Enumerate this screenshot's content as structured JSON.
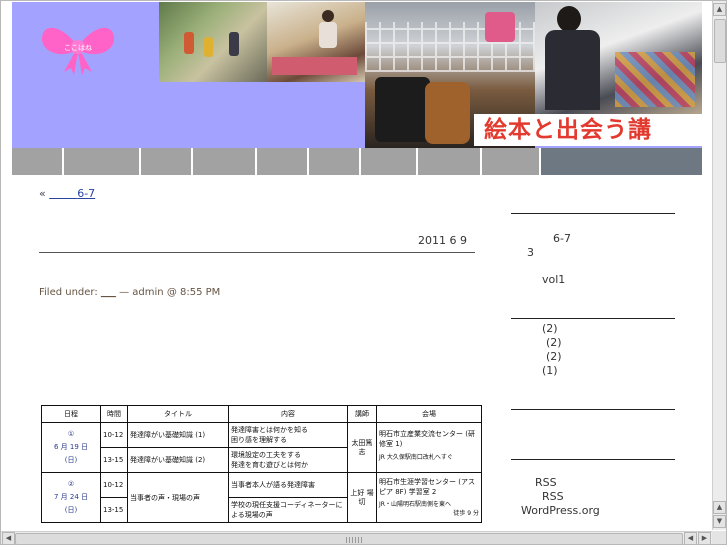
{
  "header": {
    "logo_text": "ここはね",
    "banner_title": "絵本と出会う講",
    "colors": {
      "background": "#a4a2ff",
      "logo": "#ff63c8",
      "nav": "#6e7882",
      "nav_tab": "#a2a2a2"
    }
  },
  "nav": {
    "tab_count": 10
  },
  "post": {
    "prev_prefix": "«",
    "prev_link": "6-7",
    "date": "2011  6  9",
    "filed_prefix": "Filed under:",
    "filed_category": "___",
    "filed_suffix": "— admin @ 8:55 PM"
  },
  "schedule": {
    "headers": [
      "日程",
      "時間",
      "タイトル",
      "内容",
      "講師",
      "会場"
    ],
    "rows": [
      {
        "date": [
          "①",
          "6 月 19 日",
          "(日)"
        ],
        "time": "10-12",
        "title": "発達障がい基礎知識 (1)",
        "content": "発達障害とは何かを知る\n困り感を理解する",
        "teacher": "太田篤志",
        "venue": "明石市立産業交流センター (研修室 1)",
        "venue_note": "JR 大久保駅南口改札へすぐ"
      },
      {
        "time": "13-15",
        "title": "発達障がい基礎知識 (2)",
        "content": "環境設定の工夫をする\n発達を育む遊びとは何か"
      },
      {
        "date": [
          "②",
          "7 月 24 日",
          "(日)"
        ],
        "time": "10-12",
        "title": "当事者の声・現場の声",
        "content": "当事者本人が語る発達障害",
        "teacher": "上好 場 切",
        "venue": "明石市生涯学習センター (アスピア 8F) 学習室 2",
        "venue_note": "JR・山陽明石駅南側を東へ"
      },
      {
        "time": "13-15",
        "content": "学校の現任支援コーディネーターによる現場の声",
        "venue_note2": "徒歩 9 分"
      }
    ]
  },
  "sidebar": {
    "block1": [
      "6-7",
      "3",
      "vol1"
    ],
    "block2": [
      "(2)",
      "(2)",
      "(2)",
      "(1)"
    ],
    "meta": [
      "RSS",
      "RSS",
      "WordPress.org"
    ]
  },
  "scrollbars": {
    "up": "▲",
    "down": "▼",
    "left": "◀",
    "right": "▶"
  }
}
